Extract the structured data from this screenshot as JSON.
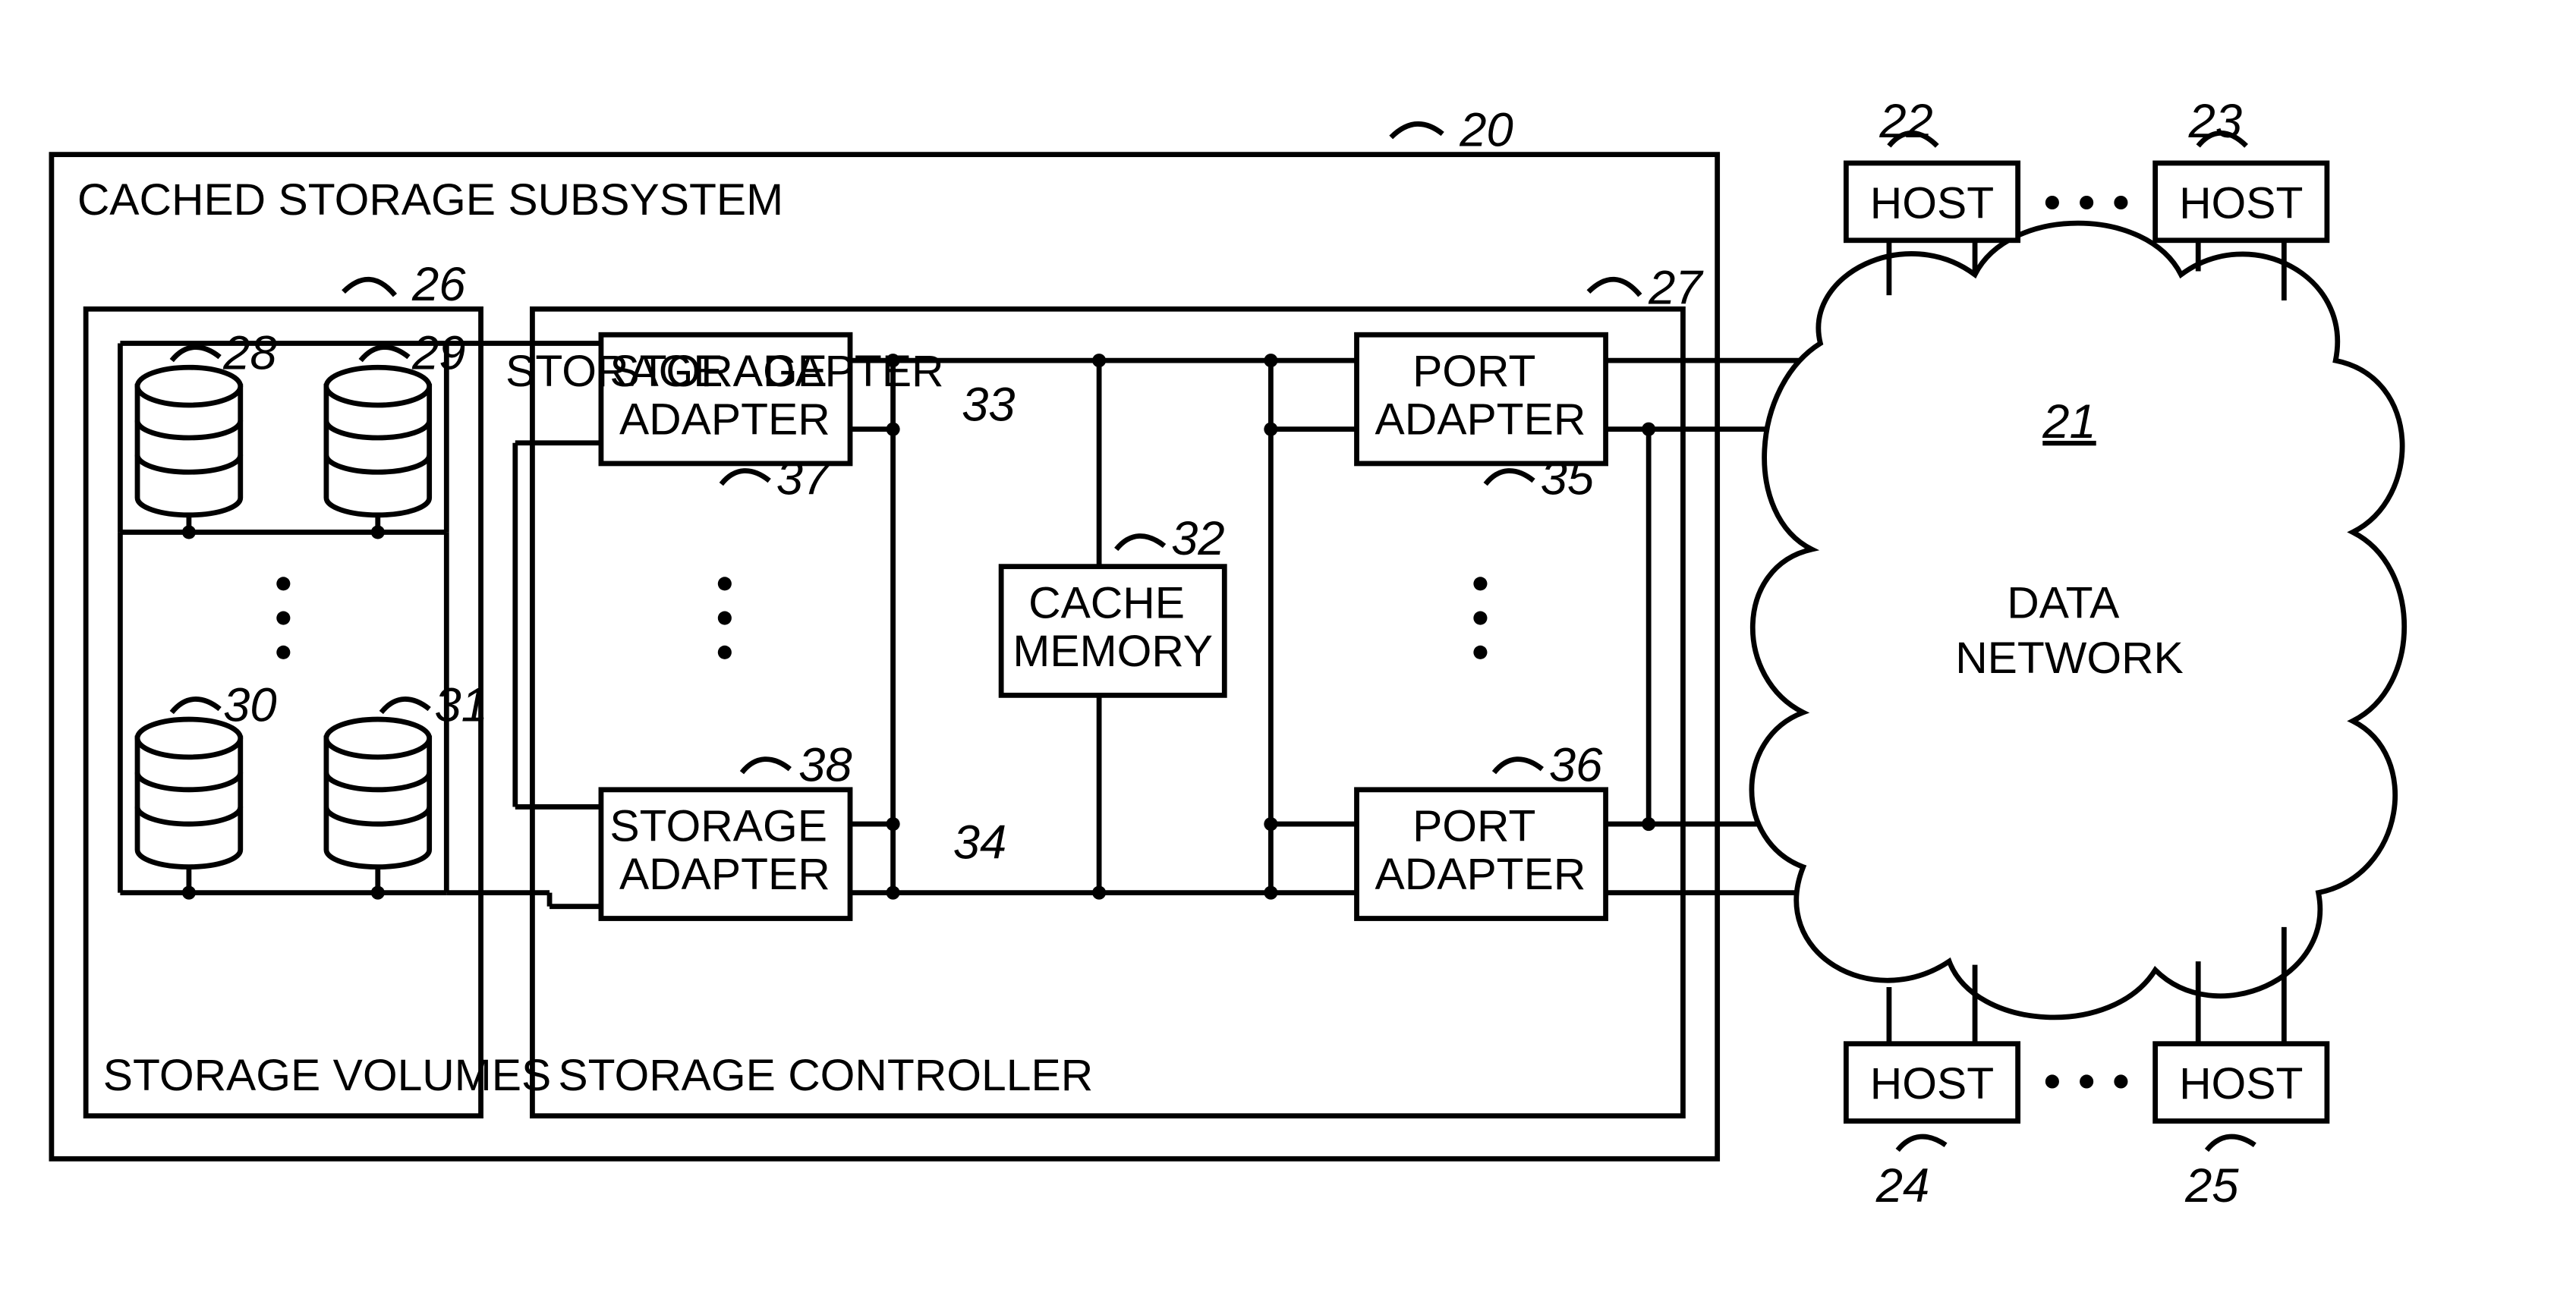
{
  "blocks": {
    "subsystem_title": "CACHED STORAGE SUBSYSTEM",
    "storage_volumes": "STORAGE VOLUMES",
    "storage_controller": "STORAGE CONTROLLER",
    "storage_adapter": "STORAGE ADAPTER",
    "port_adapter": "PORT ADAPTER",
    "cache_memory_l1": "CACHE",
    "cache_memory_l2": "MEMORY",
    "host": "HOST",
    "data_network_l1": "DATA",
    "data_network_l2": "NETWORK"
  },
  "refs": {
    "r20": "20",
    "r21": "21",
    "r22": "22",
    "r23": "23",
    "r24": "24",
    "r25": "25",
    "r26": "26",
    "r27": "27",
    "r28": "28",
    "r29": "29",
    "r30": "30",
    "r31": "31",
    "r32": "32",
    "r33": "33",
    "r34": "34",
    "r35": "35",
    "r36": "36",
    "r37": "37",
    "r38": "38"
  }
}
